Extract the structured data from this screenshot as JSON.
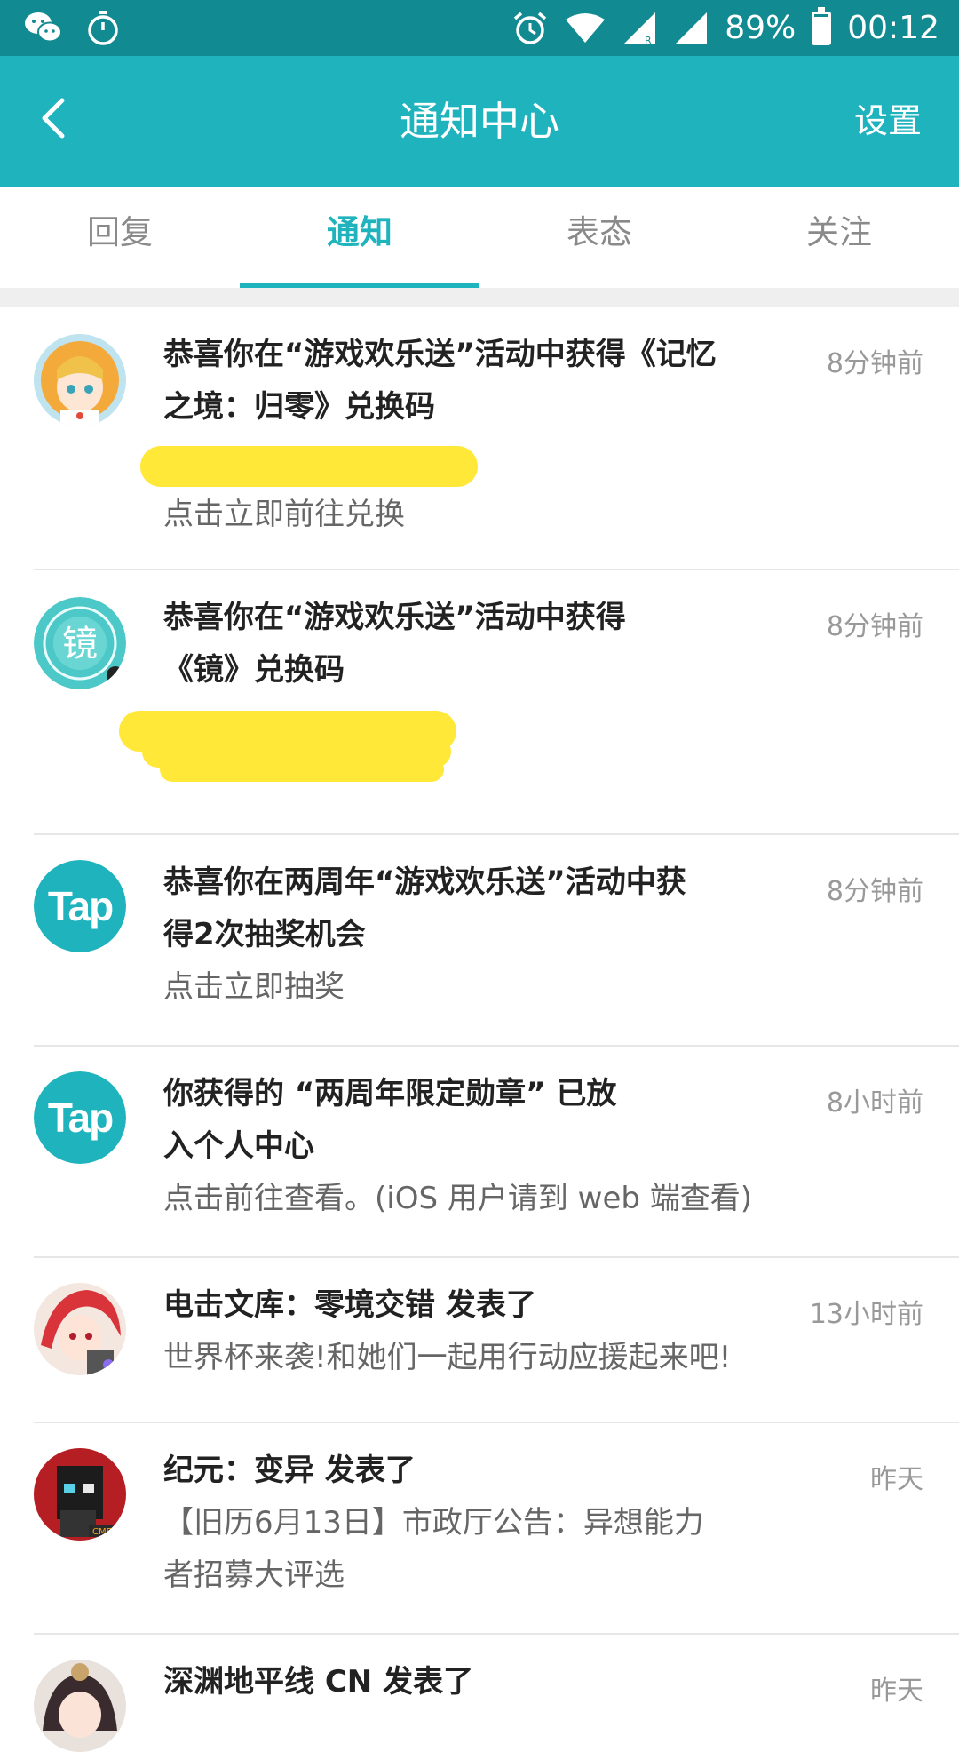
{
  "status_bar": {
    "battery": "89%",
    "time": "00:12"
  },
  "header": {
    "title": "通知中心",
    "settings": "设置"
  },
  "tabs": [
    {
      "label": "回复"
    },
    {
      "label": "通知"
    },
    {
      "label": "表态"
    },
    {
      "label": "关注"
    }
  ],
  "notifications": [
    {
      "title_line1": "恭喜你在“游戏欢乐送”活动中获得《记忆",
      "title_line2": "之境：归零》兑换码",
      "body": "点击立即前往兑换",
      "time": "8分钟前"
    },
    {
      "title_line1": "恭喜你在“游戏欢乐送”活动中获得",
      "title_line2": "《镜》兑换码",
      "time": "8分钟前",
      "avatar_text": "镜"
    },
    {
      "title_line1": "恭喜你在两周年“游戏欢乐送”活动中获",
      "title_line2": "得2次抽奖机会",
      "body": "点击立即抽奖",
      "time": "8分钟前",
      "avatar_text": "Tap"
    },
    {
      "title_line1": "你获得的 “两周年限定勋章” 已放",
      "title_line2": "入个人中心",
      "body": "点击前往查看。(iOS 用户请到 web 端查看)",
      "time": "8小时前",
      "avatar_text": "Tap"
    },
    {
      "title_line1": "电击文库：零境交错 发表了",
      "body": "世界杯来袭!和她们一起用行动应援起来吧!",
      "time": "13小时前"
    },
    {
      "title_line1": "纪元：变异 发表了",
      "body_line1": "【旧历6月13日】市政厅公告：异想能力",
      "body_line2": "者招募大评选",
      "time": "昨天"
    },
    {
      "title_line1": "深渊地平线 CN 发表了",
      "time": "昨天"
    }
  ],
  "colors": {
    "accent": "#1fb3bd",
    "statusbar": "#128a91",
    "redaction": "#ffe838"
  }
}
